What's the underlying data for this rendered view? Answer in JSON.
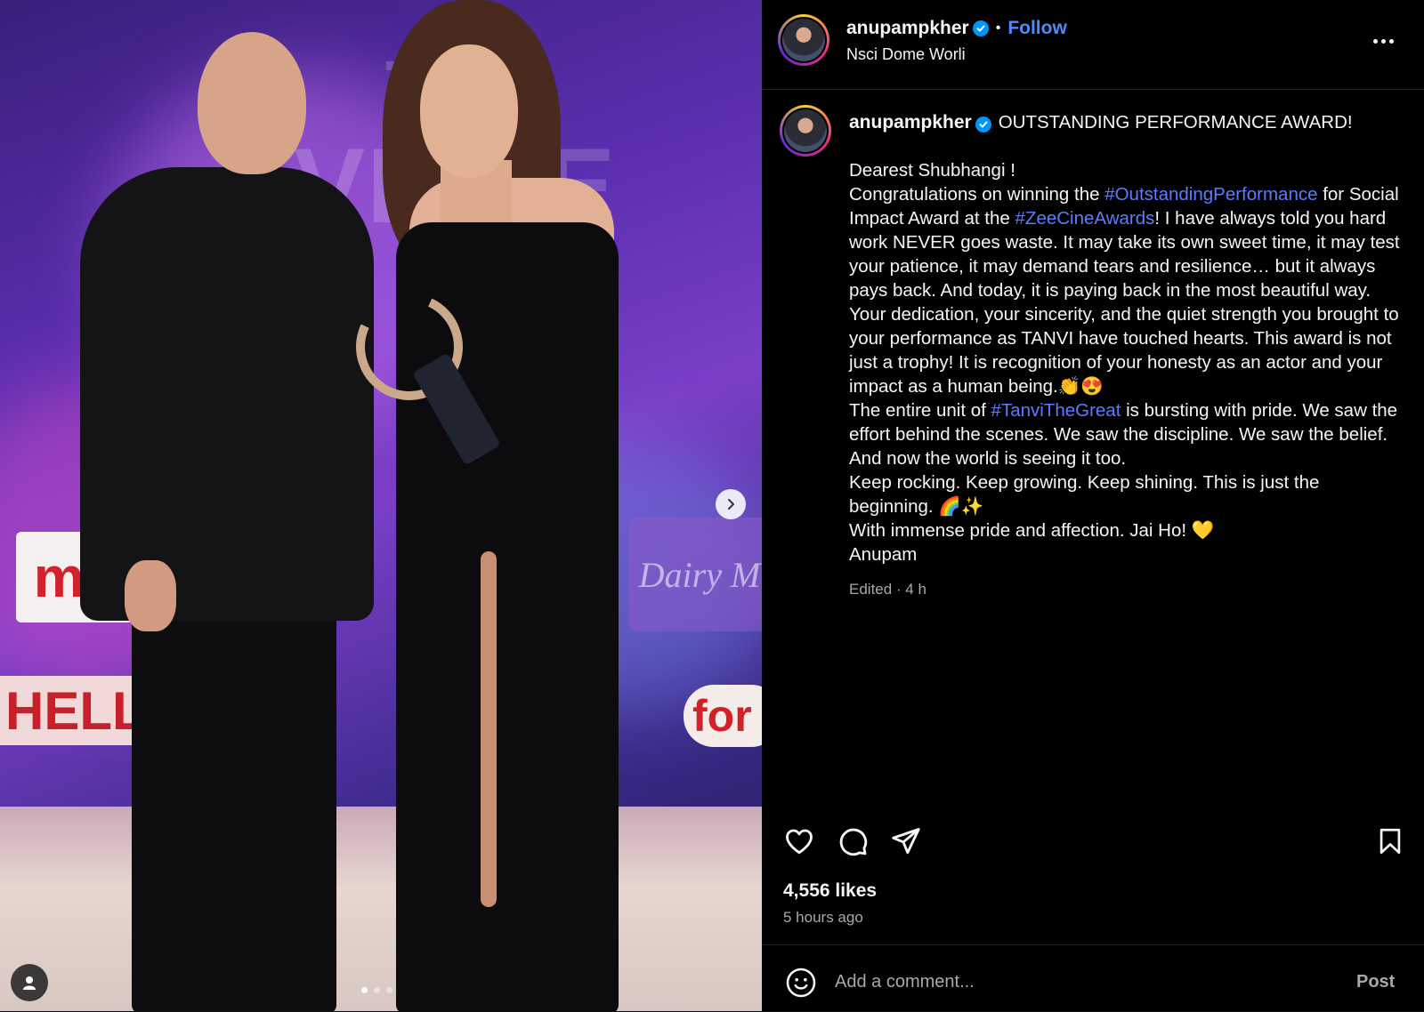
{
  "media": {
    "signs": {
      "red": "ma",
      "dairy": "Dairy M",
      "hell": "HELL",
      "for": "for"
    },
    "carousel": {
      "current": 1,
      "total": 3
    }
  },
  "header": {
    "username": "anupampkher",
    "separator": "•",
    "follow_label": "Follow",
    "location": "Nsci Dome Worli"
  },
  "caption": {
    "username": "anupampkher",
    "title": "OUTSTANDING PERFORMANCE AWARD!",
    "p1": "Dearest Shubhangi !",
    "p2_a": "Congratulations on winning the ",
    "p2_tag1": "#OutstandingPerformance",
    "p2_b": " for Social Impact Award at the ",
    "p2_tag2": "#ZeeCineAwards",
    "p2_c": "! I have always told you hard work NEVER goes waste. It may take its own sweet time, it may test your patience, it may demand tears and resilience… but it always pays back. And today, it is paying back in the most beautiful way.",
    "p3": "Your dedication, your sincerity, and the quiet strength you brought to your performance as TANVI have touched hearts. This award is not just a trophy! It is recognition of your honesty as an actor and your impact as a human being.👏😍",
    "p4_a": "The entire unit of ",
    "p4_tag": "#TanviTheGreat",
    "p4_b": " is bursting with pride. We saw the effort behind the scenes. We saw the discipline. We saw the belief. And now the world is seeing it too.",
    "p5": "Keep rocking. Keep growing. Keep shining. This is just the beginning. 🌈✨",
    "p6": "With immense pride and affection. Jai Ho! 💛",
    "p7": "Anupam",
    "edited": "Edited · 4 h"
  },
  "stats": {
    "likes": "4,556 likes",
    "time_ago": "5 hours ago"
  },
  "comment": {
    "placeholder": "Add a comment...",
    "post_label": "Post"
  },
  "icons": {
    "like": "heart-icon",
    "comment": "comment-icon",
    "share": "share-icon",
    "save": "bookmark-icon",
    "emoji": "emoji-icon",
    "more": "more-icon",
    "next": "chevron-right-icon",
    "tag": "user-tag-icon"
  },
  "colors": {
    "accent": "#4a8cff",
    "hashtag": "#5a7dff",
    "verified": "#0095f6"
  }
}
